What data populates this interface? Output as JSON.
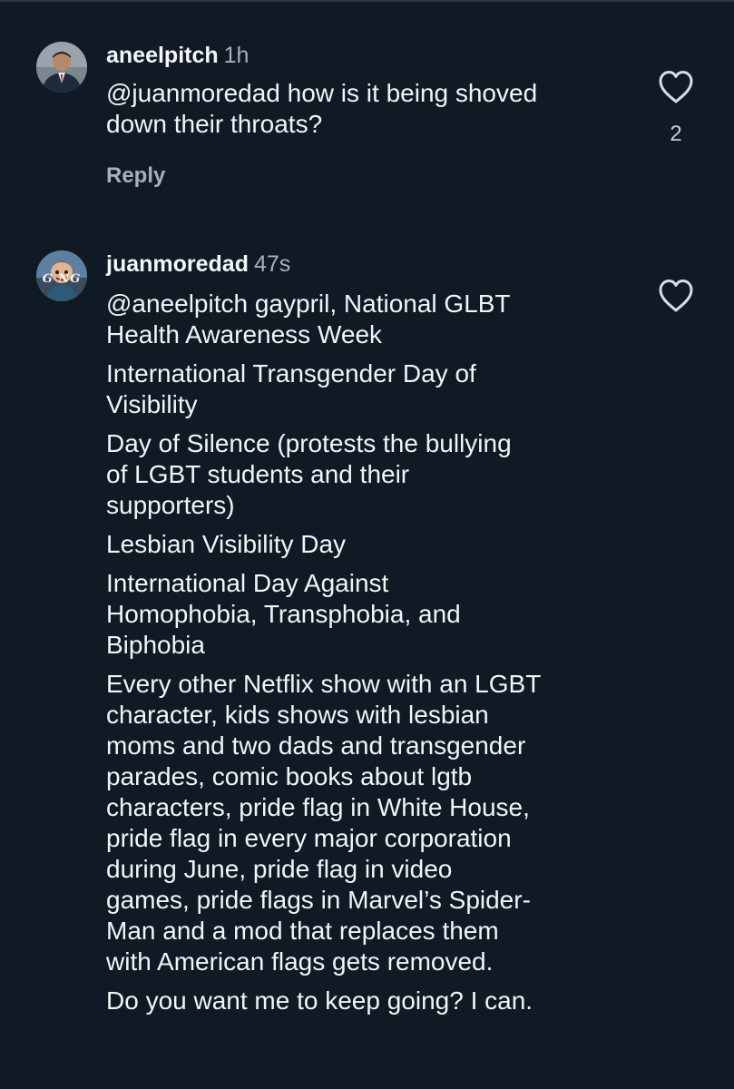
{
  "comments": [
    {
      "username": "aneelpitch",
      "time": "1h",
      "paragraphs": [
        "@juanmoredad how is it being shoved\ndown their throats?"
      ],
      "like_count": "2",
      "reply_label": "Reply",
      "avatar_icon": "person-in-suit-avatar",
      "heart_icon": "heart-outline-icon"
    },
    {
      "username": "juanmoredad",
      "time": "47s",
      "paragraphs": [
        "@aneelpitch gaypril, National GLBT\nHealth Awareness Week",
        "International Transgender Day of\nVisibility",
        "Day of Silence (protests the bullying\nof LGBT students and their\nsupporters)",
        "Lesbian Visibility Day",
        "International Day Against\nHomophobia, Transphobia, and\nBiphobia",
        "Every other Netflix show with an LGBT\ncharacter, kids shows with lesbian\nmoms and two dads and transgender\nparades, comic books about lgtb\ncharacters, pride flag in White House,\npride flag in every major corporation\nduring June, pride flag in video\ngames, pride flags in Marvel’s Spider-\nMan and a mod that replaces them\nwith American flags gets removed.",
        "Do you want me to keep going? I can."
      ],
      "avatar_icon": "cartoon-character-avatar",
      "avatar_text": "G NG",
      "heart_icon": "heart-outline-icon"
    }
  ],
  "colors": {
    "background": "#0f1a25",
    "text": "#f2f4f6",
    "secondary_text": "#a7b0ba"
  }
}
